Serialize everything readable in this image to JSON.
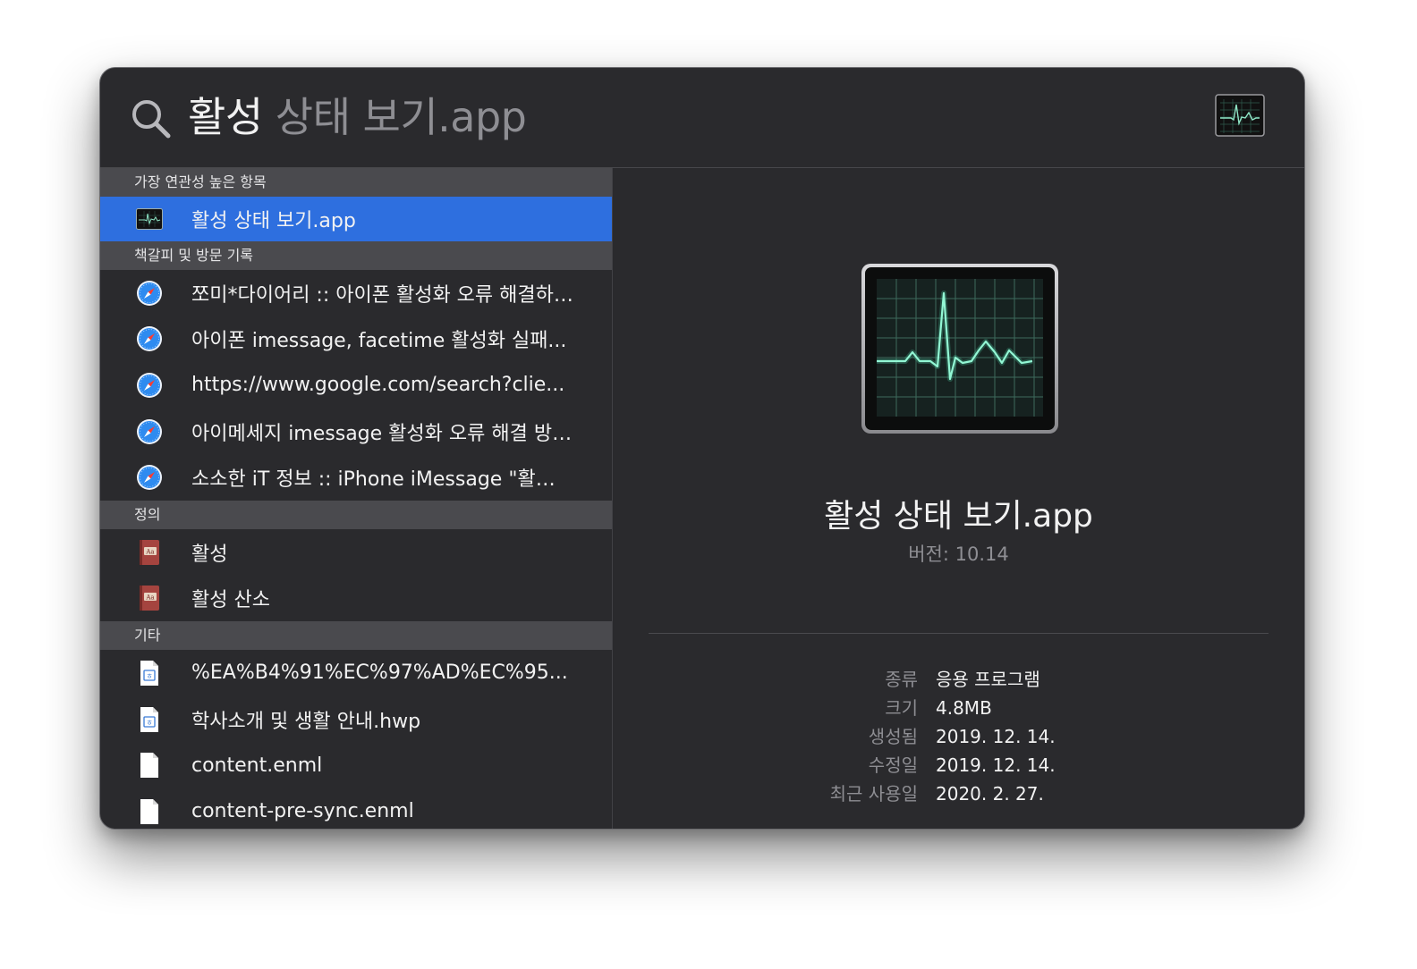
{
  "search": {
    "typed_text": "활성",
    "completion_text": " 상태 보기.app",
    "icon": "search-icon"
  },
  "header_app_icon": "activity-monitor-icon",
  "sections": [
    {
      "title": "가장 연관성 높은 항목",
      "items": [
        {
          "label": "활성 상태 보기.app",
          "icon": "activity-monitor-icon",
          "selected": true
        }
      ]
    },
    {
      "title": "책갈피 및 방문 기록",
      "items": [
        {
          "label": "쪼미*다이어리 :: 아이폰 활성화 오류 해결하…",
          "icon": "safari-compass-icon"
        },
        {
          "label": "아이폰 imessage, facetime 활성화 실패...",
          "icon": "safari-compass-icon"
        },
        {
          "label": "https://www.google.com/search?clie...",
          "icon": "safari-compass-icon"
        },
        {
          "label": "아이메세지 imessage 활성화 오류 해결 방…",
          "icon": "safari-compass-icon"
        },
        {
          "label": "소소한 iT 정보 :: iPhone iMessage \"활…",
          "icon": "safari-compass-icon"
        }
      ]
    },
    {
      "title": "정의",
      "items": [
        {
          "label": "활성",
          "icon": "dictionary-icon"
        },
        {
          "label": "활성 산소",
          "icon": "dictionary-icon"
        }
      ]
    },
    {
      "title": "기타",
      "items": [
        {
          "label": "%EA%B4%91%EC%97%AD%EC%95...",
          "icon": "hwp-document-icon"
        },
        {
          "label": "학사소개 및 생활 안내.hwp",
          "icon": "hwp-document-icon"
        },
        {
          "label": "content.enml",
          "icon": "blank-document-icon"
        },
        {
          "label": "content-pre-sync.enml",
          "icon": "blank-document-icon"
        }
      ]
    }
  ],
  "preview": {
    "title": "활성 상태 보기.app",
    "version": "버전: 10.14",
    "metadata": [
      {
        "key": "종류",
        "value": "응용 프로그램"
      },
      {
        "key": "크기",
        "value": "4.8MB"
      },
      {
        "key": "생성됨",
        "value": "2019. 12. 14."
      },
      {
        "key": "수정일",
        "value": "2019. 12. 14."
      },
      {
        "key": "최근 사용일",
        "value": "2020. 2. 27."
      }
    ]
  },
  "colors": {
    "panel_bg": "#2a2a2d",
    "section_header_bg": "#4a4a4e",
    "selection": "#2e6fdf",
    "text_primary": "#f2f2f2",
    "text_secondary": "#8e8e93"
  }
}
